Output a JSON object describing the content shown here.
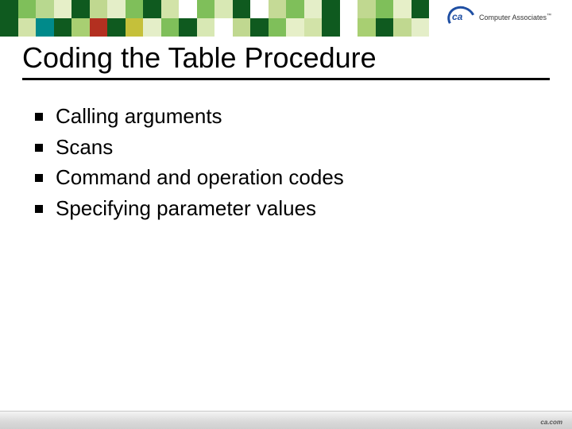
{
  "header": {
    "brand_letters": "ca",
    "brand_text": "Computer Associates",
    "mosaic_colors": [
      "#0f5a1f",
      "#7fbf5a",
      "#b8d88f",
      "#e6efc8",
      "#0f5a1f",
      "#c0d890",
      "#e4eec8",
      "#7fbf5a",
      "#0f5a1f",
      "#d2e3a8",
      "#ffffff",
      "#7fbf5a",
      "#d8e8b4",
      "#0f5a1f",
      "#ffffff",
      "#c5da96",
      "#7fbf5a",
      "#e4eec8",
      "#0f5a1f",
      "#ffffff",
      "#c0d890",
      "#7fbf5a",
      "#e6efc8",
      "#0f5a1f",
      "#ffffff",
      "#ffffff",
      "#ffffff",
      "#ffffff",
      "#ffffff",
      "#ffffff",
      "#ffffff",
      "#ffffff",
      "#0f5a1f",
      "#d2e3a8",
      "#008a8a",
      "#0f5a1f",
      "#a8cf72",
      "#b33020",
      "#0f5a1f",
      "#c5c03a",
      "#e4eec8",
      "#7fbf5a",
      "#0f5a1f",
      "#d8e8b4",
      "#ffffff",
      "#c0d890",
      "#0f5a1f",
      "#7fbf5a",
      "#e6efc8",
      "#d2e3a8",
      "#0f5a1f",
      "#ffffff",
      "#a8cf72",
      "#0f5a1f",
      "#c0d890",
      "#e4eec8",
      "#ffffff",
      "#ffffff",
      "#ffffff",
      "#ffffff",
      "#ffffff",
      "#ffffff",
      "#ffffff",
      "#ffffff"
    ]
  },
  "title": "Coding the Table Procedure",
  "bullets": [
    "Calling arguments",
    "Scans",
    "Command and operation codes",
    "Specifying parameter values"
  ],
  "footer": {
    "brand": "ca.com"
  }
}
